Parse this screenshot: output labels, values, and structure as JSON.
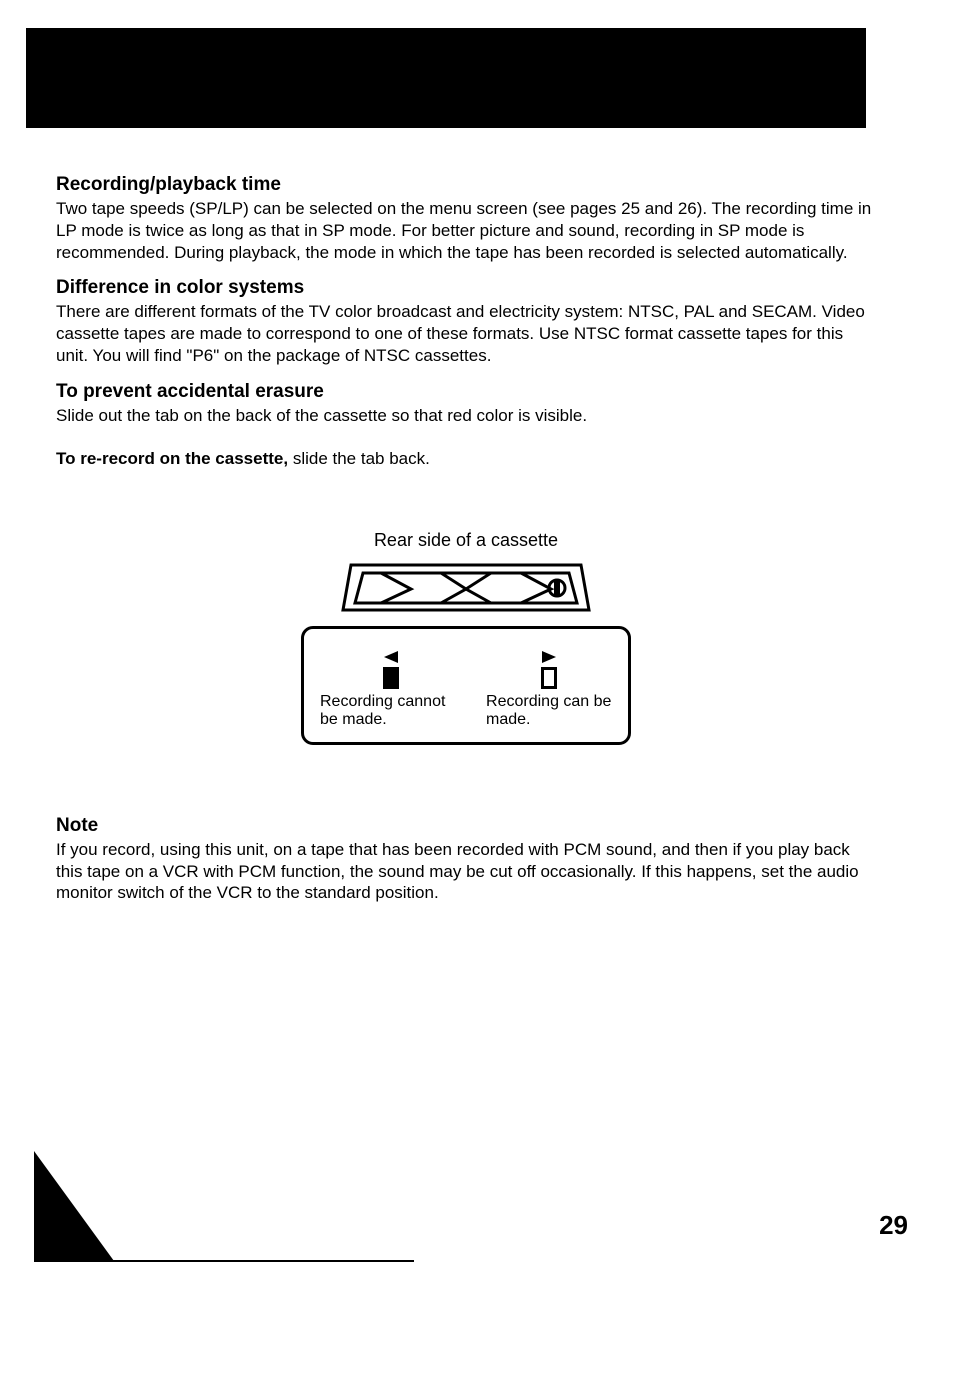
{
  "sections": {
    "recording_time": {
      "heading": "Recording/playback time",
      "body": "Two tape speeds (SP/LP) can be selected on the menu screen (see pages 25 and 26). The recording time in LP mode is twice as long as that in SP mode. For better picture and sound, recording in SP mode is recommended. During playback, the mode in which the tape has been recorded is selected automatically."
    },
    "color_systems": {
      "heading": "Difference in color systems",
      "body": "There are different formats of the TV color broadcast and electricity system: NTSC, PAL and SECAM. Video cassette tapes are made to correspond to one of these formats. Use NTSC format cassette tapes for this unit. You will find \"P6\" on the package of NTSC cassettes."
    },
    "erasure": {
      "heading": "To prevent accidental erasure",
      "body": "Slide out the tab on the back of the cassette so that red color is visible.",
      "rerecord_lead": "To re-record on the cassette,",
      "rerecord_rest": " slide the tab back."
    },
    "diagram": {
      "caption": "Rear side of a cassette",
      "state_closed": "Recording cannot be made.",
      "state_open": "Recording can be made."
    },
    "note": {
      "heading": "Note",
      "body": "If you record, using this unit, on a tape that has been recorded with PCM sound, and then if you play back this tape on a VCR with PCM function, the sound may be cut off occasionally. If this happens, set the audio monitor switch of the VCR to the standard position."
    }
  },
  "page_number": "29"
}
